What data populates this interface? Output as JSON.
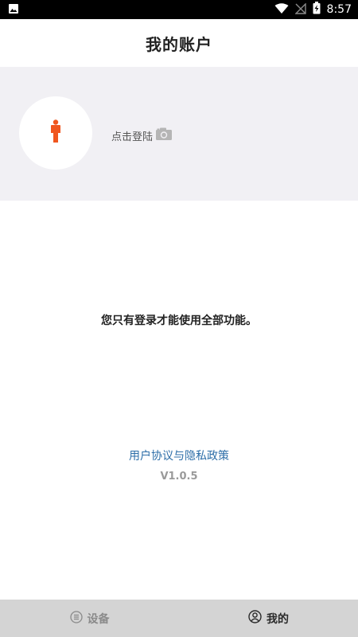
{
  "status_bar": {
    "time": "8:57",
    "icons": [
      "image-notification-icon",
      "wifi-icon",
      "no-signal-icon",
      "battery-charging-icon"
    ]
  },
  "header": {
    "title": "我的账户"
  },
  "profile": {
    "avatar_icon": "person-icon",
    "login_label": "点击登陆",
    "camera_icon": "camera-icon",
    "accent_color": "#f0561f"
  },
  "main": {
    "message": "您只有登录才能使用全部功能。",
    "policy_link": "用户协议与隐私政策",
    "version": "V1.0.5"
  },
  "tabs": [
    {
      "label": "设备",
      "icon": "list-icon",
      "active": false
    },
    {
      "label": "我的",
      "icon": "user-circle-icon",
      "active": true
    }
  ]
}
